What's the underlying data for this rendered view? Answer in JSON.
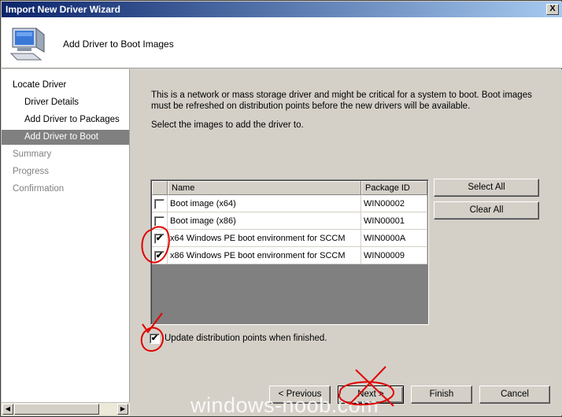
{
  "window": {
    "title": "Import New Driver Wizard",
    "close_label": "X"
  },
  "header": {
    "page_title": "Add Driver to Boot Images",
    "icon": "computer-icon"
  },
  "sidebar": {
    "items": [
      {
        "label": "Locate Driver"
      },
      {
        "label": "Driver Details"
      },
      {
        "label": "Add Driver to Packages"
      },
      {
        "label": "Add Driver to Boot Images"
      },
      {
        "label": "Summary"
      },
      {
        "label": "Progress"
      },
      {
        "label": "Confirmation"
      }
    ],
    "active_index": 3
  },
  "content": {
    "description": "This is a network or mass storage driver and might be critical for a system to boot.  Boot images must be refreshed on distribution points before the new drivers will be available.",
    "instruction": "Select the images to add the driver to.",
    "table": {
      "columns": [
        "Name",
        "Package ID"
      ],
      "rows": [
        {
          "name": "Boot image (x64)",
          "package_id": "WIN00002",
          "checked": false
        },
        {
          "name": "Boot image (x86)",
          "package_id": "WIN00001",
          "checked": false
        },
        {
          "name": "x64 Windows PE boot environment for SCCM",
          "package_id": "WIN0000A",
          "checked": true
        },
        {
          "name": "x86 Windows PE boot environment for SCCM",
          "package_id": "WIN00009",
          "checked": true
        }
      ]
    },
    "select_all_label": "Select All",
    "clear_all_label": "Clear All",
    "update_label": "Update distribution points when finished.",
    "update_checked": true
  },
  "footer": {
    "previous_label": "< Previous",
    "next_label": "Next >",
    "finish_label": "Finish",
    "cancel_label": "Cancel"
  },
  "watermark": "windows-noob.com",
  "colors": {
    "titlebar_start": "#0a246a",
    "titlebar_end": "#a6caf0",
    "annotation": "#e00000",
    "active_nav": "#808080"
  }
}
